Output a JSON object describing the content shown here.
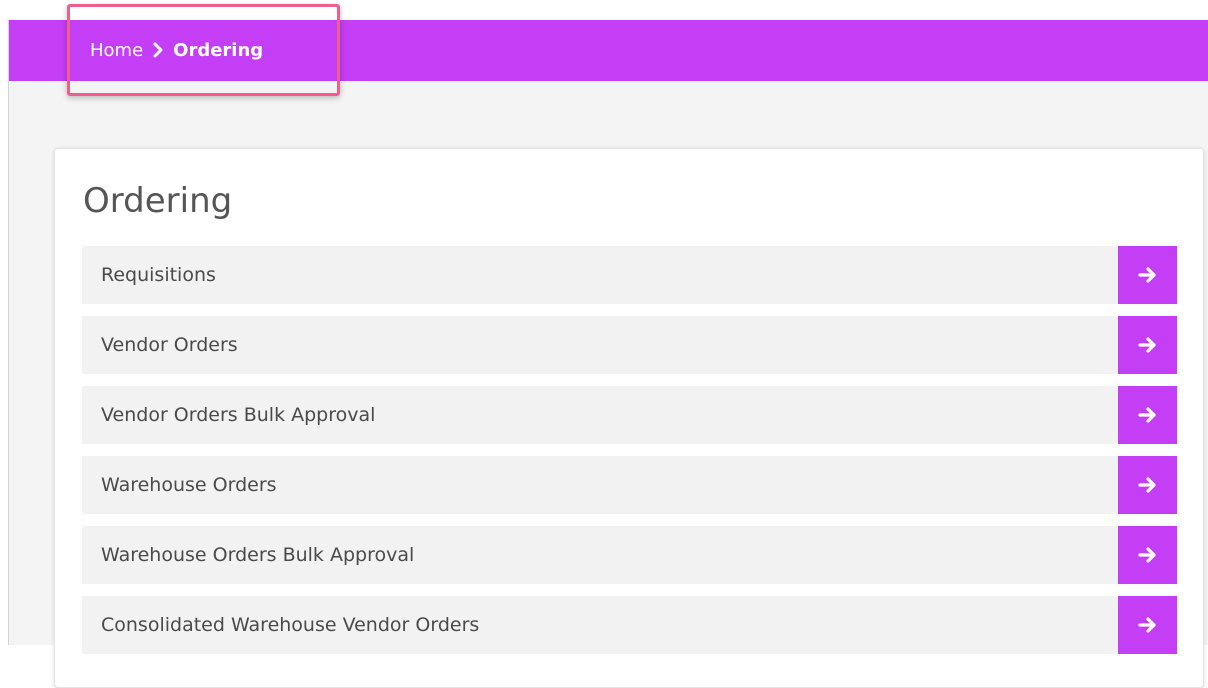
{
  "breadcrumb": {
    "home": "Home",
    "separator_icon": "chevron-right-icon",
    "current": "Ordering"
  },
  "page": {
    "title": "Ordering"
  },
  "menu": {
    "arrow_icon": "arrow-right-icon",
    "items": [
      {
        "label": "Requisitions"
      },
      {
        "label": "Vendor Orders"
      },
      {
        "label": "Vendor Orders Bulk Approval"
      },
      {
        "label": "Warehouse Orders"
      },
      {
        "label": "Warehouse Orders Bulk Approval"
      },
      {
        "label": "Consolidated Warehouse Vendor Orders"
      }
    ]
  },
  "colors": {
    "accent": "#c43ef5",
    "highlight_border": "#ee5f8f",
    "page_background": "#f4f4f4",
    "item_background": "#f2f2f2"
  }
}
